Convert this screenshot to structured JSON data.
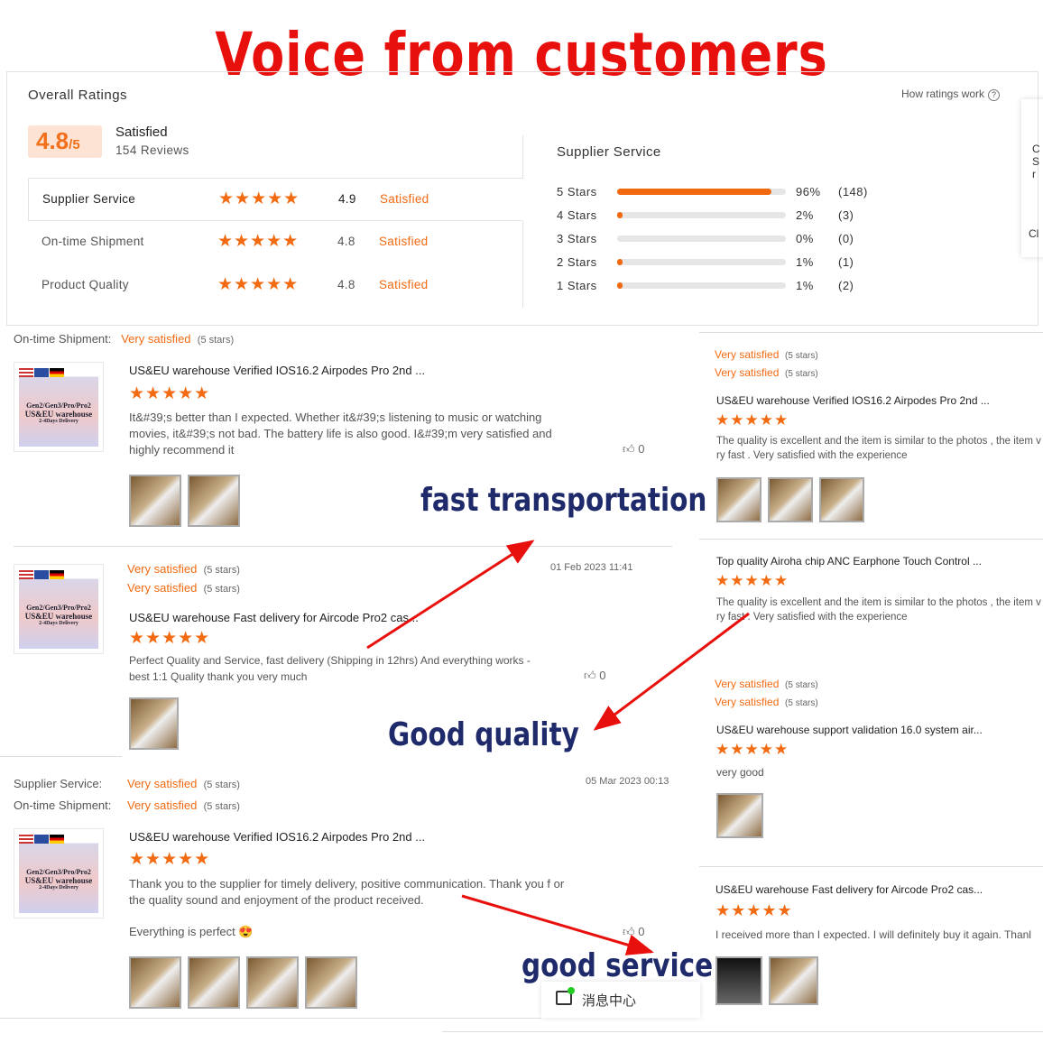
{
  "banner": {
    "title": "Voice from customers"
  },
  "overall": {
    "heading": "Overall Ratings",
    "how_link": "How ratings work",
    "help_icon": "?",
    "score": "4.8",
    "out_of": "/5",
    "label": "Satisfied",
    "reviews": "154 Reviews",
    "rows": [
      {
        "label": "Supplier Service",
        "score": "4.9",
        "status": "Satisfied"
      },
      {
        "label": "On-time Shipment",
        "score": "4.8",
        "status": "Satisfied"
      },
      {
        "label": "Product Quality",
        "score": "4.8",
        "status": "Satisfied"
      }
    ]
  },
  "supplier": {
    "heading": "Supplier Service",
    "bars": [
      {
        "label": "5  Stars",
        "percent": 96,
        "pct": "96%",
        "count": "(148)"
      },
      {
        "label": "4  Stars",
        "percent": 2,
        "pct": "2%",
        "count": "(3)"
      },
      {
        "label": "3  Stars",
        "percent": 0,
        "pct": "0%",
        "count": "(0)"
      },
      {
        "label": "2  Stars",
        "percent": 1,
        "pct": "1%",
        "count": "(1)"
      },
      {
        "label": "1  Stars",
        "percent": 1,
        "pct": "1%",
        "count": "(2)"
      }
    ]
  },
  "side_card": {
    "lines": [
      "C",
      "S",
      "r",
      "Cl"
    ]
  },
  "stars": "★★★★★",
  "thumb": {
    "line1": "Gen2/Gen3/Pro/Pro2",
    "line2": "US&EU warehouse",
    "line3": "2-4Days Delivery",
    "tag": "US&EU Warehouse"
  },
  "left_reviews": [
    {
      "ratings": [
        {
          "label": "On-time Shipment:",
          "value": "Very satisfied",
          "stars": "(5 stars)"
        }
      ],
      "title": "US&EU warehouse Verified IOS16.2 Airpodes Pro 2nd ...",
      "text": "It&#39;s better than I expected. Whether it&#39;s listening to music or watching movies, it&#39;s not bad. The battery life is also good. I&#39;m very satisfied and highly recommend it",
      "likes": "0"
    },
    {
      "ratings": [
        {
          "label": "",
          "value": "Very satisfied",
          "stars": "(5 stars)"
        },
        {
          "label": "",
          "value": "Very satisfied",
          "stars": "(5 stars)"
        }
      ],
      "date": "01 Feb 2023 11:41",
      "title": "US&EU warehouse Fast delivery for Aircode Pro2 cas...",
      "text": "Perfect Quality and Service, fast delivery (Shipping in 12hrs) And everything works - best 1:1 Quality thank you very much",
      "likes": "0"
    },
    {
      "ratings": [
        {
          "label": "Supplier Service:",
          "value": "Very satisfied",
          "stars": "(5 stars)"
        },
        {
          "label": "On-time Shipment:",
          "value": "Very satisfied",
          "stars": "(5 stars)"
        }
      ],
      "date": "05 Mar 2023 00:13",
      "title": "US&EU warehouse Verified IOS16.2 Airpodes Pro 2nd ...",
      "text": "Thank you to the supplier for timely delivery, positive communication. Thank you f or the quality sound and enjoyment of the product received.",
      "extra": "Everything is perfect 😍",
      "likes": "0"
    }
  ],
  "right_reviews": [
    {
      "ratings": [
        "Very satisfied",
        "Very satisfied"
      ],
      "stars_label": "(5 stars)",
      "title": "US&EU warehouse Verified IOS16.2 Airpodes Pro 2nd ...",
      "text": "The quality is excellent and the item is similar to the photos , the item v ry fast . Very satisfied with the experience"
    },
    {
      "title": "Top quality Airoha chip ANC Earphone Touch Control ...",
      "text": "The quality is excellent and the item is similar to the photos , the item v ry fast . Very satisfied with the experience"
    },
    {
      "ratings": [
        "Very satisfied",
        "Very satisfied"
      ],
      "stars_label": "(5 stars)",
      "title": "US&EU warehouse support validation 16.0 system air...",
      "text": "very good"
    },
    {
      "title": "US&EU warehouse Fast delivery for Aircode Pro2 cas...",
      "text": "I received more than I expected. I will definitely buy it again. Thanl"
    }
  ],
  "annotations": {
    "fast": "fast transportation",
    "quality": "Good quality",
    "service": "good service"
  },
  "message_center": {
    "label": "消息中心",
    "icon": "chat-icon"
  },
  "colors": {
    "accent": "#f26a11",
    "banner": "#e8100c",
    "annotation": "#1f2a6b",
    "arrow": "#e8100c"
  }
}
